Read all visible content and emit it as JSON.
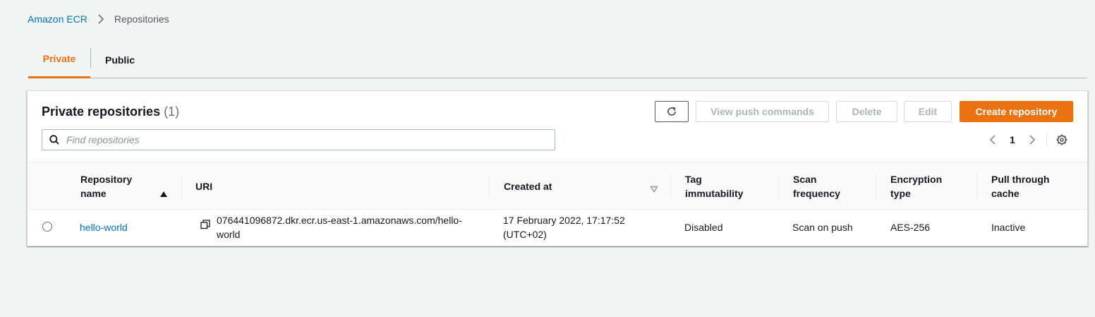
{
  "breadcrumb": {
    "service": "Amazon ECR",
    "current": "Repositories"
  },
  "tabs": [
    {
      "label": "Private",
      "active": true
    },
    {
      "label": "Public",
      "active": false
    }
  ],
  "panel": {
    "title": "Private repositories",
    "count": "(1)"
  },
  "toolbar": {
    "refresh_icon": "refresh-icon",
    "view_push_commands": "View push commands",
    "delete": "Delete",
    "edit": "Edit",
    "create_repository": "Create repository"
  },
  "search": {
    "placeholder": "Find repositories"
  },
  "pagination": {
    "page": "1"
  },
  "table": {
    "columns": [
      {
        "label": "Repository\nname",
        "sort": "ascending"
      },
      {
        "label": "URI"
      },
      {
        "label": "Created at",
        "sort": "sortable"
      },
      {
        "label": "Tag\nimmutability"
      },
      {
        "label": "Scan\nfrequency"
      },
      {
        "label": "Encryption\ntype"
      },
      {
        "label": "Pull through\ncache"
      }
    ],
    "rows": [
      {
        "name": "hello-world",
        "uri_line1": "076441096872.dkr.ecr.us-east-1.amazonaws.com/hello-",
        "uri_line2": "world",
        "created_line1": "17 February 2022, 17:17:52",
        "created_line2": "(UTC+02)",
        "tag_immutability": "Disabled",
        "scan_frequency": "Scan on push",
        "encryption_type": "AES-256",
        "pull_through_cache": "Inactive"
      }
    ]
  },
  "colors": {
    "accent": "#ec7211",
    "link": "#0073bb",
    "background": "#f2f3f3"
  }
}
